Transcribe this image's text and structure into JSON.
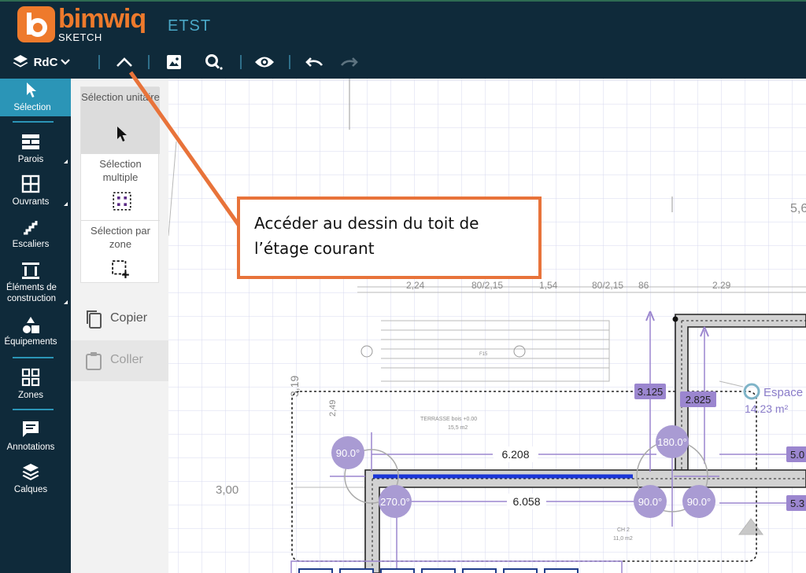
{
  "app": {
    "brand_name": "bimwiq",
    "brand_sub": "SKETCH",
    "project": "ETST"
  },
  "toolbar": {
    "level": "RdC",
    "icons": [
      "layers-icon",
      "chevron-down-icon",
      "roof-icon",
      "image-icon",
      "zoom-search-icon",
      "eye-icon",
      "undo-icon",
      "redo-icon"
    ]
  },
  "nav": {
    "items": [
      {
        "label": "Sélection",
        "icon": "cursor-icon"
      },
      {
        "label": "Parois",
        "icon": "brick-wall-icon"
      },
      {
        "label": "Ouvrants",
        "icon": "window-icon"
      },
      {
        "label": "Escaliers",
        "icon": "stairs-icon"
      },
      {
        "label": "Éléments de construction",
        "icon": "column-icon"
      },
      {
        "label": "Équipements",
        "icon": "shapes-icon"
      },
      {
        "label": "Zones",
        "icon": "zones-grid-icon"
      },
      {
        "label": "Annotations",
        "icon": "comment-icon"
      },
      {
        "label": "Calques",
        "icon": "layers-stack-icon"
      }
    ]
  },
  "selection_panel": {
    "options": [
      {
        "label": "Sélection unitaire"
      },
      {
        "label": "Sélection multiple"
      },
      {
        "label": "Sélection par zone"
      }
    ],
    "copy_label": "Copier",
    "paste_label": "Coller"
  },
  "callout": {
    "text": "Accéder au dessin du toit de l’étage courant"
  },
  "plan": {
    "dimensions_top": [
      "2,24",
      "80/2,15",
      "1,54",
      "80/2,15",
      "86",
      "2.29"
    ],
    "dim_left_1": "3,19",
    "dim_left_2": "2,49",
    "dim_3": "3,00",
    "dim_5": "5,6",
    "terrasse_label": "TERRASSE bois +0.00",
    "terrasse_area": "15,5 m2",
    "f15": "F15",
    "ch2": "CH 2",
    "ch2_area": "11,0 m2",
    "measure_6208": "6.208",
    "measure_6058": "6.058",
    "tag_3125": "3.125",
    "tag_2825": "2.825",
    "tag_50": "5.0",
    "tag_53": "5.3",
    "angle_90_a": "90.0°",
    "angle_270": "270.0°",
    "angle_180": "180.0°",
    "angle_90_b": "90.0°",
    "angle_90_c": "90.0°",
    "space_name": "Espace",
    "space_area": "14.23 m²"
  },
  "colors": {
    "nav_bg": "#0f2a3a",
    "nav_active": "#2b95b7",
    "brand_orange": "#ee7a2c",
    "callout_border": "#e8733a",
    "purple": "#9b86cf",
    "wall_blue": "#1b36d8"
  }
}
